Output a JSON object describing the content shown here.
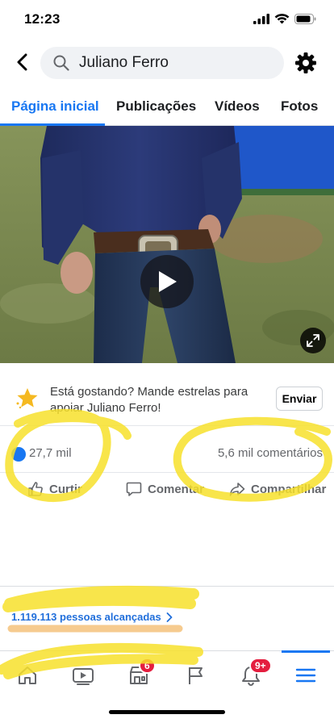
{
  "status_bar": {
    "time": "12:23"
  },
  "search": {
    "query": "Juliano Ferro"
  },
  "tabs": [
    {
      "label": "Página inicial",
      "active": true
    },
    {
      "label": "Publicações",
      "active": false
    },
    {
      "label": "Vídeos",
      "active": false
    },
    {
      "label": "Fotos",
      "active": false
    }
  ],
  "stars_promo": {
    "text": "Está gostando? Mande estrelas para apoiar Juliano Ferro!",
    "button_label": "Enviar"
  },
  "reactions": {
    "likes": "27,7 mil",
    "comments": "5,6 mil comentários"
  },
  "actions": {
    "like": "Curtir",
    "comment": "Comentar",
    "share": "Compartilhar"
  },
  "reach": {
    "text": "1.119.113 pessoas alcançadas"
  },
  "bottom_nav": {
    "marketplace_badge": "6",
    "notifications_badge": "9+",
    "items": [
      "home-icon",
      "watch-icon",
      "marketplace-icon",
      "pages-flag-icon",
      "notifications-bell-icon",
      "menu-icon"
    ],
    "active": "menu-icon"
  },
  "colors": {
    "accent": "#1877f2",
    "highlighter": "#f7e12b",
    "badge": "#e41e3f",
    "reach_underline": "#f6c98a"
  }
}
